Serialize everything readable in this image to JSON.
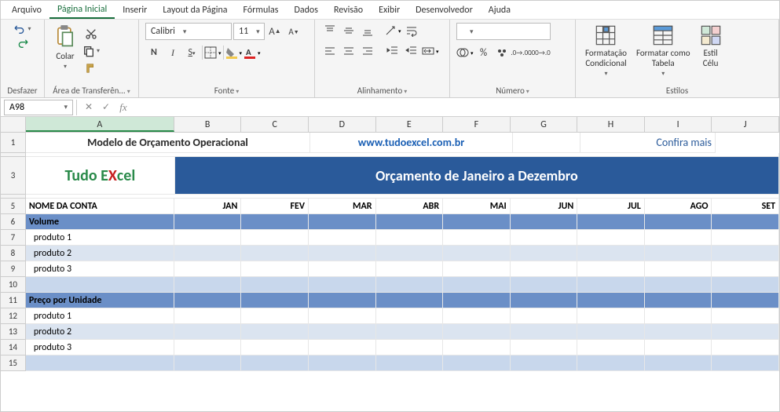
{
  "menu": {
    "arquivo": "Arquivo",
    "inicial": "Página Inicial",
    "inserir": "Inserir",
    "layout": "Layout da Página",
    "formulas": "Fórmulas",
    "dados": "Dados",
    "revisao": "Revisão",
    "exibir": "Exibir",
    "desenvolvedor": "Desenvolvedor",
    "ajuda": "Ajuda"
  },
  "ribbon": {
    "desfazer": "Desfazer",
    "colar": "Colar",
    "clipboard": "Área de Transferên...",
    "fonte": "Fonte",
    "fontname": "Calibri",
    "fontsize": "11",
    "alinhamento": "Alinhamento",
    "numero": "Número",
    "estilos": "Estilos",
    "condicional": "Formatação\nCondicional",
    "tabela": "Formatar como\nTabela",
    "celula": "Estil\nCélu"
  },
  "namebox": "A98",
  "cols": {
    "A": "A",
    "B": "B",
    "C": "C",
    "D": "D",
    "E": "E",
    "F": "F",
    "G": "G",
    "H": "H",
    "I": "I",
    "J": "J"
  },
  "sheet": {
    "title": "Modelo de Orçamento Operacional",
    "url": "www.tudoexcel.com.br",
    "confira": "Confira mais",
    "logo_tudo": "Tudo E",
    "logo_x": "X",
    "logo_cel": "cel",
    "banner": "Orçamento de Janeiro a Dezembro",
    "nomeconta": "NOME DA CONTA",
    "months": {
      "jan": "JAN",
      "fev": "FEV",
      "mar": "MAR",
      "abr": "ABR",
      "mai": "MAI",
      "jun": "JUN",
      "jul": "JUL",
      "ago": "AGO",
      "set": "SET"
    },
    "volume": "Volume",
    "preco": "Preço por Unidade",
    "p1": "produto 1",
    "p2": "produto 2",
    "p3": "produto 3"
  }
}
